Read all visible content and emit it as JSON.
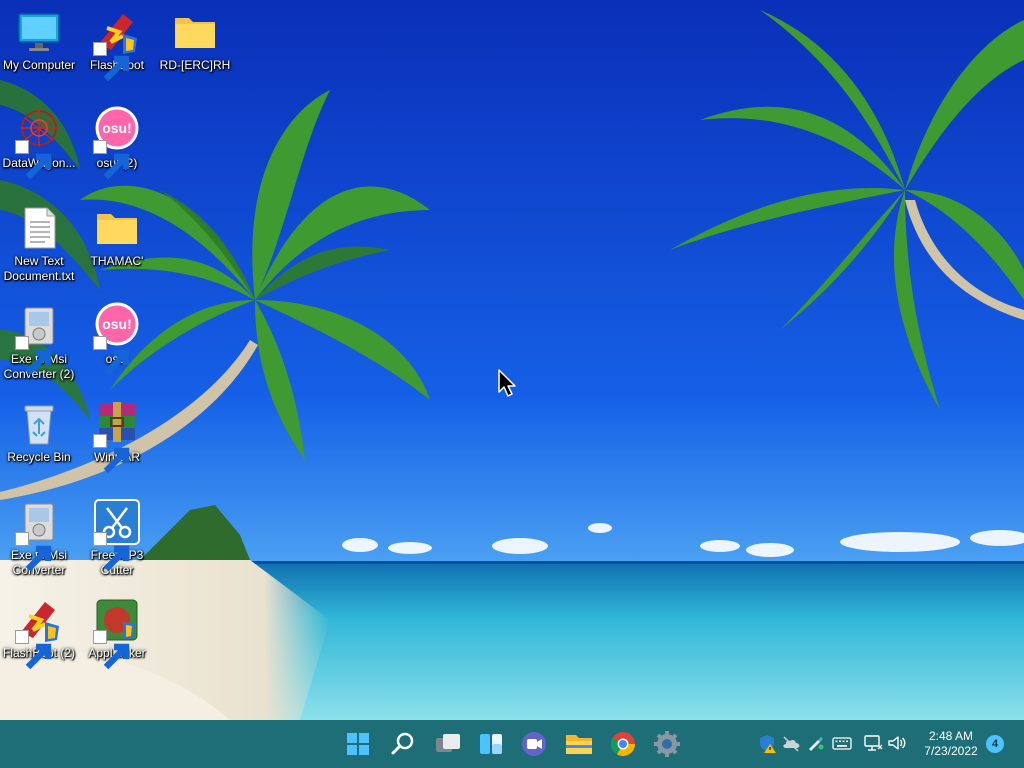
{
  "desktop": {
    "icons": [
      {
        "label": "My Computer",
        "icon": "monitor-icon"
      },
      {
        "label": "FlashBoot",
        "icon": "flashboot-icon"
      },
      {
        "label": "RD-[ERC]RH",
        "icon": "folder-icon"
      },
      {
        "label": "DataWagon...",
        "icon": "datawagon-icon"
      },
      {
        "label": "osu! (2)",
        "icon": "osu-icon"
      },
      {
        "label": "New Text Document.txt",
        "icon": "text-file-icon"
      },
      {
        "label": "THAMAC'",
        "icon": "folder-icon"
      },
      {
        "label": "Exe to Msi Converter (2)",
        "icon": "installer-icon"
      },
      {
        "label": "osu!",
        "icon": "osu-icon"
      },
      {
        "label": "Recycle Bin",
        "icon": "recycle-bin-icon"
      },
      {
        "label": "WinRAR",
        "icon": "winrar-icon"
      },
      {
        "label": "Exe to Msi Converter",
        "icon": "installer-icon"
      },
      {
        "label": "Free MP3 Cutter",
        "icon": "scissors-icon"
      },
      {
        "label": "FlashBoot (2)",
        "icon": "flashboot-icon"
      },
      {
        "label": "AppLocker",
        "icon": "applocker-icon"
      }
    ]
  },
  "taskbar": {
    "pinned": [
      "start-icon",
      "search-icon",
      "task-view-icon",
      "widgets-icon",
      "teams-chat-icon",
      "file-explorer-icon",
      "chrome-icon",
      "settings-icon"
    ],
    "tray": [
      "windows-security-icon",
      "onedrive-icon",
      "pen-icon",
      "keyboard-icon",
      "network-icon",
      "volume-icon"
    ],
    "clock": {
      "time": "2:48 AM",
      "date": "7/23/2022"
    },
    "notification_count": "4"
  },
  "colors": {
    "taskbar": "#1e6e77",
    "sky_top": "#0a2fb8",
    "sea": "#2fb7d6",
    "accent": "#4cc2ff"
  }
}
